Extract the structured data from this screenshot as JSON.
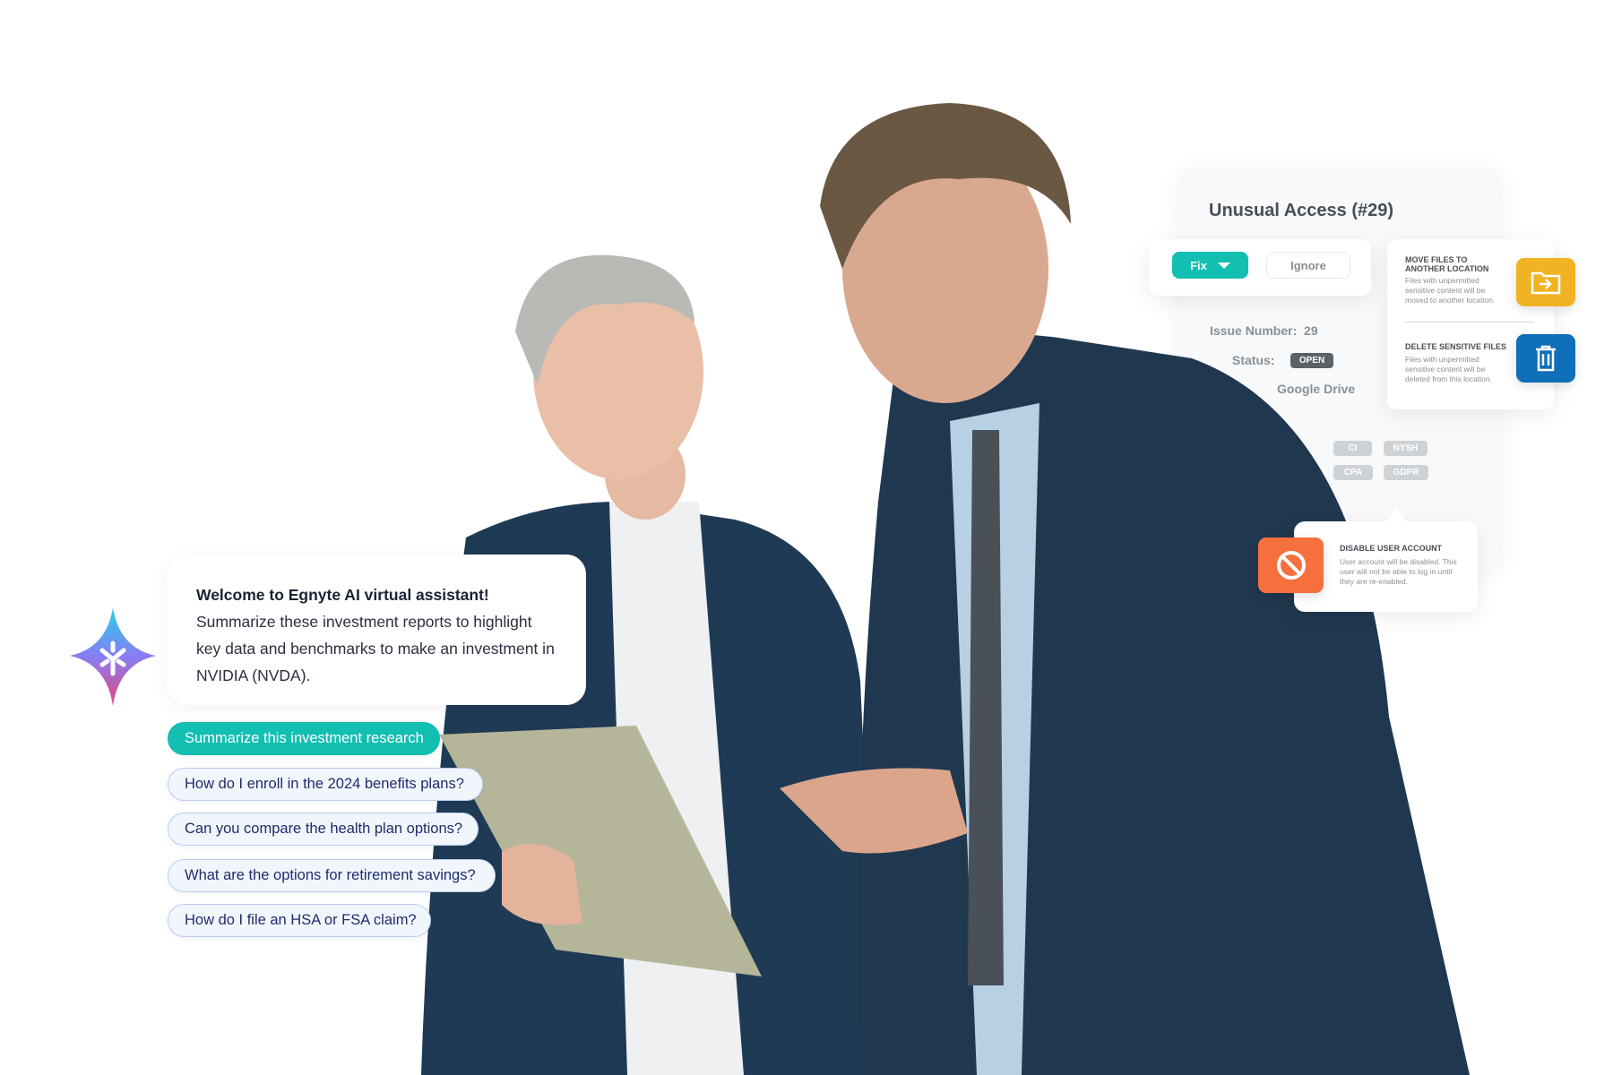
{
  "security_panel": {
    "title": "Unusual Access (#29)",
    "fix_label": "Fix",
    "ignore_label": "Ignore",
    "issue_number_label": "Issue Number:",
    "issue_number": "29",
    "status_label": "Status:",
    "status_value": "OPEN",
    "source_value": "Google Drive",
    "tags": [
      "CI",
      "NYSH",
      "CPA",
      "GDPR"
    ],
    "actions": [
      {
        "title": "MOVE FILES TO ANOTHER LOCATION",
        "desc": "Files with unpermitted sensitive content will be moved to another location.",
        "icon": "folder-move-icon",
        "color": "#f0b323"
      },
      {
        "title": "DELETE SENSITIVE FILES",
        "desc": "Files with unpermitted sensitive content will be deleted from this location.",
        "icon": "trash-icon",
        "color": "#0f6fb8"
      }
    ],
    "disable": {
      "title": "DISABLE USER ACCOUNT",
      "desc": "User account will be disabled. This user will not be able to log in until they are re-enabled.",
      "icon": "block-icon",
      "color": "#f5703d"
    }
  },
  "assistant": {
    "welcome": "Welcome to Egnyte AI virtual assistant!",
    "message": "Summarize these investment reports to highlight key data and benchmarks to make an investment in NVIDIA (NVDA).",
    "suggestions": [
      "Summarize this investment research",
      "How do I enroll in the 2024 benefits plans?",
      "Can you compare the health plan options?",
      "What are the options for retirement savings?",
      "How do I file an HSA or FSA claim?"
    ],
    "accent": "#12bfb1"
  }
}
